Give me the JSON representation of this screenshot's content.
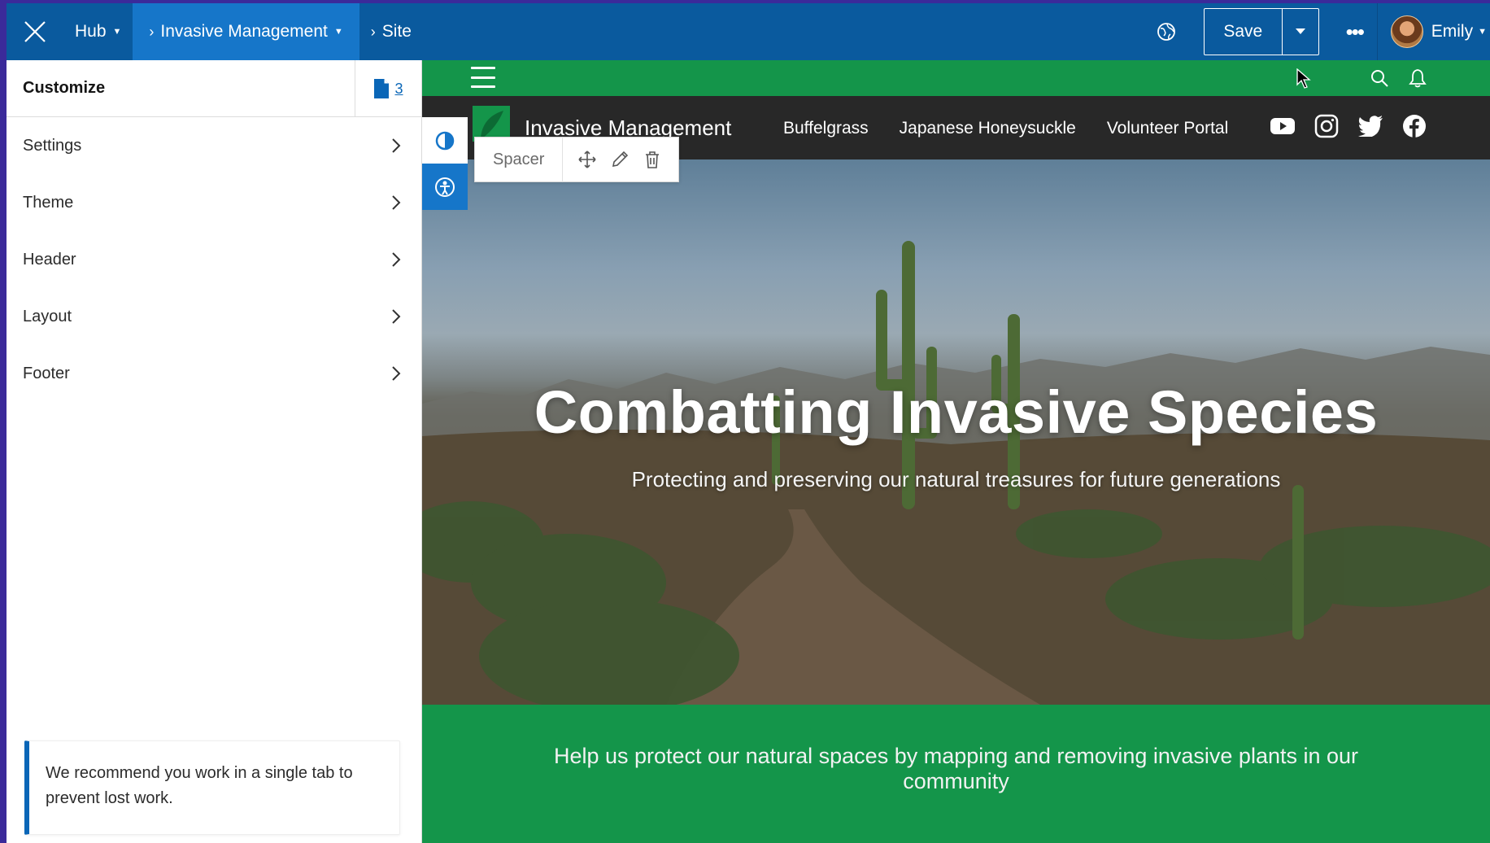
{
  "topbar": {
    "breadcrumbs": [
      {
        "label": "Hub",
        "has_caret": true
      },
      {
        "label": "Invasive Management",
        "has_caret": true
      },
      {
        "label": "Site",
        "has_caret": false
      }
    ],
    "save_label": "Save",
    "more_label": "•••",
    "user_name": "Emily",
    "icons": [
      "close-icon",
      "globe-icon",
      "chevron-down-icon",
      "more-icon",
      "avatar"
    ]
  },
  "sidebar": {
    "title": "Customize",
    "page_count": "3",
    "items": [
      {
        "label": "Settings"
      },
      {
        "label": "Theme"
      },
      {
        "label": "Header"
      },
      {
        "label": "Layout"
      },
      {
        "label": "Footer"
      }
    ],
    "notice": "We recommend you work in a single tab to prevent lost work."
  },
  "toolstrip": {
    "tools": [
      "contrast-icon",
      "accessibility-icon"
    ]
  },
  "spacer_toolbar": {
    "label": "Spacer",
    "tools": [
      "move-icon",
      "edit-icon",
      "delete-icon"
    ]
  },
  "site": {
    "name": "Invasive Management",
    "nav": [
      "Buffelgrass",
      "Japanese Honeysuckle",
      "Volunteer Portal"
    ],
    "social": [
      "youtube-icon",
      "instagram-icon",
      "twitter-icon",
      "facebook-icon"
    ],
    "hero_title": "Combatting Invasive Species",
    "hero_subtitle": "Protecting and preserving our natural treasures for future generations",
    "cta_text": "Help us protect our natural spaces by mapping and removing invasive plants in our community"
  },
  "colors": {
    "app_blue": "#0a5a9e",
    "active_crumb": "#1676c9",
    "site_green": "#14954a",
    "site_nav": "#282828",
    "accent_link": "#0a66b7",
    "frame": "#3b2a9a"
  }
}
